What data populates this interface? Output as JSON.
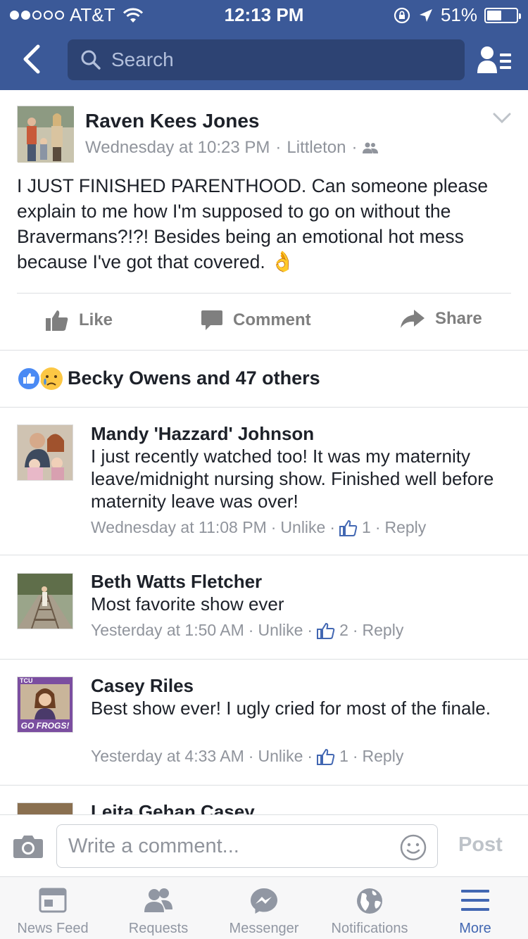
{
  "status_bar": {
    "carrier": "AT&T",
    "time": "12:13 PM",
    "battery": "51%",
    "battery_level": 0.51,
    "signal_bars_filled": 2,
    "signal_bars_total": 5
  },
  "header": {
    "search_placeholder": "Search"
  },
  "post": {
    "author": "Raven Kees Jones",
    "timestamp": "Wednesday at 10:23 PM",
    "location": "Littleton",
    "text": "I JUST FINISHED PARENTHOOD. Can someone please explain to me how I'm supposed to go on without the Bravermans?!?! Besides being an emotional hot mess because I've got that covered.",
    "emoji": "👌"
  },
  "actions": {
    "like": "Like",
    "comment": "Comment",
    "share": "Share"
  },
  "reactions": {
    "summary": "Becky Owens and 47 others"
  },
  "comments": [
    {
      "name": "Mandy 'Hazzard' Johnson",
      "text": "I just recently watched too! It was my maternity leave/midnight nursing show. Finished well before maternity leave was over!",
      "time": "Wednesday at 11:08 PM",
      "unlike": "Unlike",
      "likes": "1",
      "reply": "Reply"
    },
    {
      "name": "Beth Watts Fletcher",
      "text": "Most favorite show ever",
      "time": "Yesterday at 1:50 AM",
      "unlike": "Unlike",
      "likes": "2",
      "reply": "Reply"
    },
    {
      "name": "Casey Riles",
      "text": "Best show ever!  I ugly cried for most of the finale.",
      "time": "Yesterday at 4:33 AM",
      "unlike": "Unlike",
      "likes": "1",
      "reply": "Reply"
    },
    {
      "name": "Leita Gehan Casey"
    }
  ],
  "avatar_badges": {
    "casey_top": "TCU",
    "casey_bottom": "GO FROGS!"
  },
  "composer": {
    "placeholder": "Write a comment...",
    "post_label": "Post"
  },
  "tabbar": {
    "items": [
      {
        "label": "News Feed",
        "icon": "news-feed-icon"
      },
      {
        "label": "Requests",
        "icon": "friend-requests-icon"
      },
      {
        "label": "Messenger",
        "icon": "messenger-icon"
      },
      {
        "label": "Notifications",
        "icon": "globe-icon"
      },
      {
        "label": "More",
        "icon": "hamburger-menu-icon"
      }
    ],
    "active_index": 4
  },
  "colors": {
    "brand_blue": "#3b5998",
    "search_bg": "#2d4373",
    "like_blue": "#4267b2",
    "meta_gray": "#90949c"
  }
}
